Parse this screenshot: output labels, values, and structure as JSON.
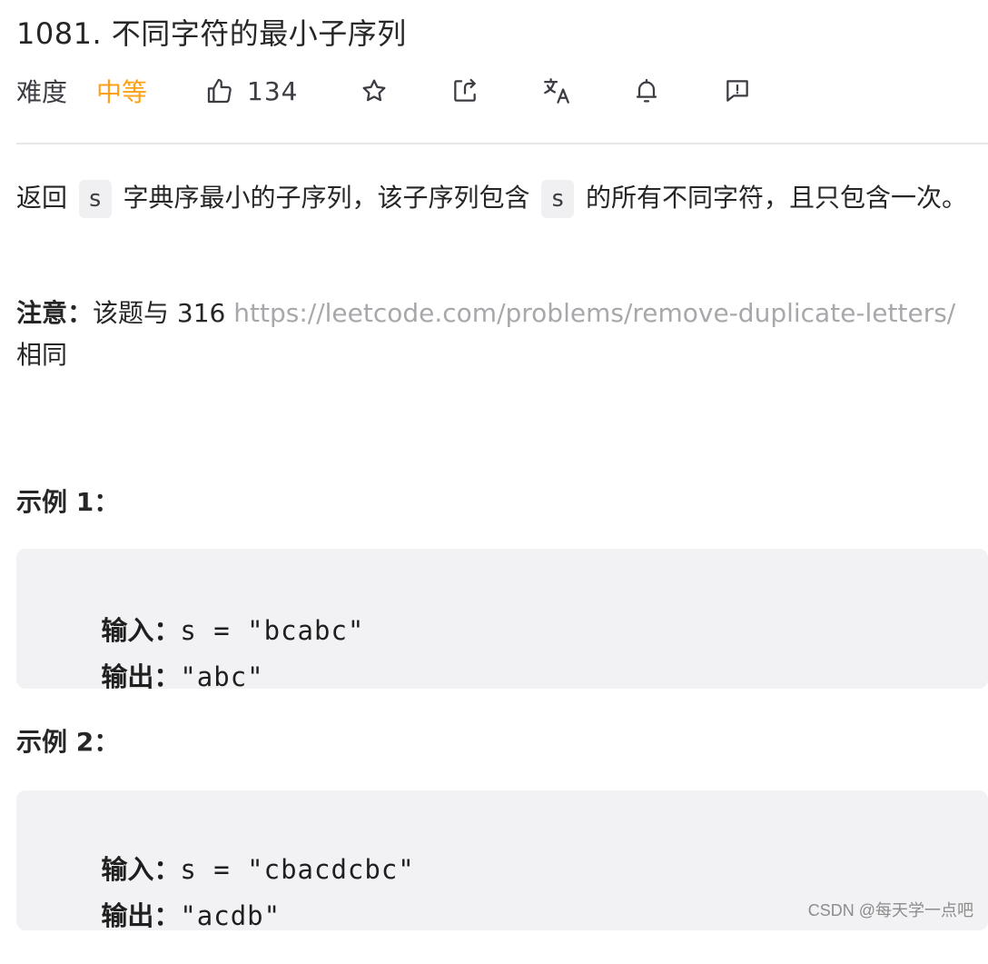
{
  "problem": {
    "title": "1081. 不同字符的最小子序列"
  },
  "meta": {
    "difficulty_label": "难度",
    "difficulty_value": "中等",
    "likes": "134",
    "icons": [
      "thumbs-up-icon",
      "star-icon",
      "share-icon",
      "translate-icon",
      "bell-icon",
      "feedback-icon"
    ],
    "difficulty_color": "#ffa116"
  },
  "description": {
    "part1": "返回",
    "code1": "s",
    "part2": "字典序最小的子序列，该子序列包含",
    "code2": "s",
    "part3": "的所有不同字符，且只包含一次。"
  },
  "note": {
    "label": "注意：",
    "text_before": "该题与 316 ",
    "link": "https://leetcode.com/problems/remove-duplicate-letters/",
    "text_after": " 相同"
  },
  "examples": [
    {
      "heading": "示例 1：",
      "input_label": "输入：",
      "input_value": "s = \"bcabc\"",
      "output_label": "输出：",
      "output_value": "\"abc\""
    },
    {
      "heading": "示例 2：",
      "input_label": "输入：",
      "input_value": "s = \"cbacdcbc\"",
      "output_label": "输出：",
      "output_value": "\"acdb\""
    }
  ],
  "watermark": "CSDN @每天学一点吧"
}
